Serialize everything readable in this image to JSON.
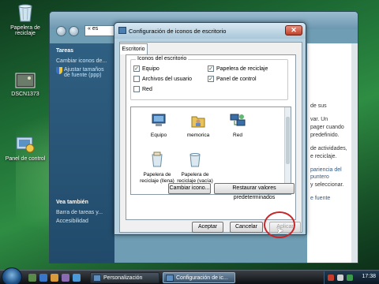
{
  "desktop": {
    "icons": [
      {
        "label": "Papelera de reciclaje",
        "icon": "recycle-bin-icon"
      },
      {
        "label": "DSCN1373",
        "icon": "photo-icon"
      },
      {
        "label": "Panel de control",
        "icon": "control-panel-icon"
      }
    ]
  },
  "background_window": {
    "address": "« es",
    "tasks_heading": "Tareas",
    "tasks": [
      "Cambiar iconos de...",
      "Ajustar tamaños de fuente (ppp)"
    ],
    "see_also_heading": "Vea también",
    "see_also": [
      "Barra de tareas y...",
      "Accesibilidad"
    ],
    "right_lines": [
      {
        "text": "de sus",
        "link": false
      },
      {
        "text": "",
        "link": false
      },
      {
        "text": "var. Un",
        "link": false
      },
      {
        "text": "pager cuando",
        "link": false
      },
      {
        "text": "predefinido.",
        "link": false
      },
      {
        "text": "",
        "link": false
      },
      {
        "text": "de actividades,",
        "link": false
      },
      {
        "text": "e reciclaje.",
        "link": false
      },
      {
        "text": "",
        "link": false
      },
      {
        "text": "pariencia del puntero",
        "link": true
      },
      {
        "text": "y seleccionar.",
        "link": false
      },
      {
        "text": "",
        "link": false
      },
      {
        "text": "e fuente",
        "link": true
      }
    ]
  },
  "dialog": {
    "title": "Configuración de iconos de escritorio",
    "tab": "Escritorio",
    "group_title": "Iconos del escritorio",
    "checkboxes": [
      {
        "label": "Equipo",
        "checked": true
      },
      {
        "label": "Papelera de reciclaje",
        "checked": true
      },
      {
        "label": "Archivos del usuario",
        "checked": false
      },
      {
        "label": "Panel de control",
        "checked": true
      },
      {
        "label": "Red",
        "checked": false
      }
    ],
    "list_items": [
      {
        "label": "Equipo",
        "icon": "computer-icon"
      },
      {
        "label": "memorica",
        "icon": "user-folder-icon"
      },
      {
        "label": "Red",
        "icon": "network-icon"
      },
      {
        "label": "Papelera de reciclaje (llena)",
        "icon": "recycle-bin-full-icon"
      },
      {
        "label": "Papelera de reciclaje (vacía)",
        "icon": "recycle-bin-empty-icon"
      }
    ],
    "change_icon_button": "Cambiar icono...",
    "restore_button": "Restaurar valores predeterminados",
    "ok_button": "Aceptar",
    "cancel_button": "Cancelar",
    "apply_button": "Aplicar"
  },
  "taskbar": {
    "tasks": [
      {
        "label": "Personalización",
        "active": false
      },
      {
        "label": "Configuración de ic...",
        "active": true
      }
    ],
    "clock": "17:38"
  }
}
